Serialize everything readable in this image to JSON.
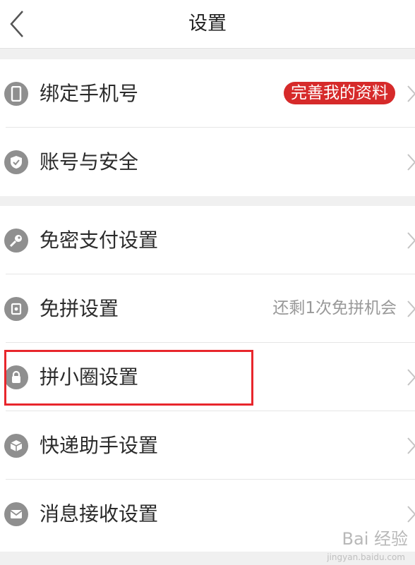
{
  "header": {
    "title": "设置"
  },
  "groups": [
    {
      "items": [
        {
          "label": "绑定手机号",
          "icon": "phone-icon",
          "badge": "完善我的资料"
        },
        {
          "label": "账号与安全",
          "icon": "shield-check-icon"
        }
      ]
    },
    {
      "items": [
        {
          "label": "免密支付设置",
          "icon": "key-icon"
        },
        {
          "label": "免拼设置",
          "icon": "coupon-icon",
          "value": "还剩1次免拼机会"
        },
        {
          "label": "拼小圈设置",
          "icon": "circle-icon"
        },
        {
          "label": "快递助手设置",
          "icon": "package-icon"
        },
        {
          "label": "消息接收设置",
          "icon": "mail-icon"
        }
      ]
    }
  ],
  "colors": {
    "badge": "#d62a2a",
    "highlight": "#e8262c",
    "icon": "#8f8f8f"
  },
  "watermark": {
    "text": "Bai 经验",
    "url": "jingyan.baidu.com"
  }
}
